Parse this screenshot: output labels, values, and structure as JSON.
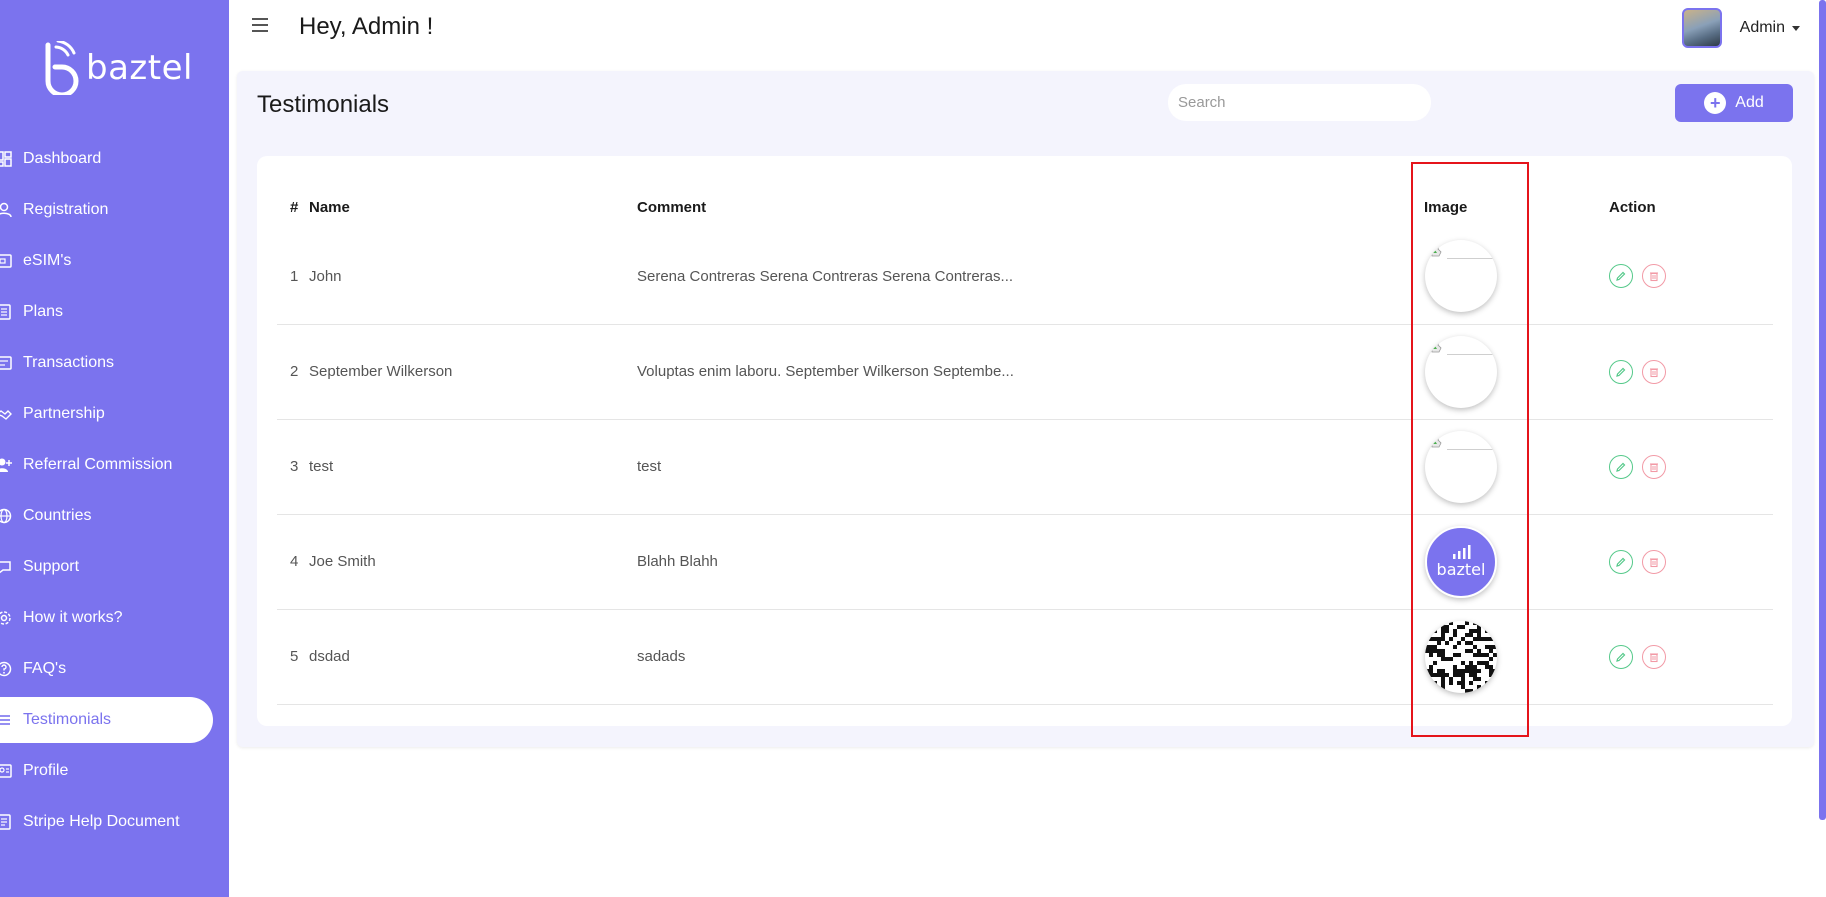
{
  "sidebar": {
    "logo_text": "baztel",
    "items": [
      {
        "label": "Dashboard",
        "icon": "dashboard-icon"
      },
      {
        "label": "Registration",
        "icon": "user-icon"
      },
      {
        "label": "eSIM's",
        "icon": "sim-icon"
      },
      {
        "label": "Plans",
        "icon": "plans-icon"
      },
      {
        "label": "Transactions",
        "icon": "transactions-icon"
      },
      {
        "label": "Partnership",
        "icon": "handshake-icon"
      },
      {
        "label": "Referral Commission",
        "icon": "user-plus-icon"
      },
      {
        "label": "Countries",
        "icon": "globe-icon"
      },
      {
        "label": "Support",
        "icon": "chat-icon"
      },
      {
        "label": "How it works?",
        "icon": "gear-icon"
      },
      {
        "label": "FAQ's",
        "icon": "question-icon"
      },
      {
        "label": "Testimonials",
        "icon": "list-icon",
        "active": true
      },
      {
        "label": "Profile",
        "icon": "profile-icon"
      },
      {
        "label": "Stripe Help Document",
        "icon": "document-icon"
      }
    ]
  },
  "header": {
    "greeting": "Hey, Admin !",
    "user_name": "Admin"
  },
  "page": {
    "title": "Testimonials",
    "search_placeholder": "Search",
    "add_label": "Add"
  },
  "table": {
    "columns": [
      "#",
      "Name",
      "Comment",
      "Image",
      "Action"
    ],
    "rows": [
      {
        "num": "1",
        "name": "John",
        "comment": "Serena Contreras Serena Contreras Serena Contreras...",
        "image": "broken"
      },
      {
        "num": "2",
        "name": "September Wilkerson",
        "comment": "Voluptas enim laboru. September Wilkerson Septembe...",
        "image": "broken"
      },
      {
        "num": "3",
        "name": "test",
        "comment": "test",
        "image": "broken"
      },
      {
        "num": "4",
        "name": "Joe Smith",
        "comment": "Blahh Blahh",
        "image": "baztel-logo"
      },
      {
        "num": "5",
        "name": "dsdad",
        "comment": "sadads",
        "image": "qr-code"
      }
    ],
    "brand_thumb_text": "baztel"
  },
  "colors": {
    "accent": "#7b73ee",
    "edit": "#55c98a",
    "delete": "#f29aa6",
    "highlight": "#e5141b"
  }
}
